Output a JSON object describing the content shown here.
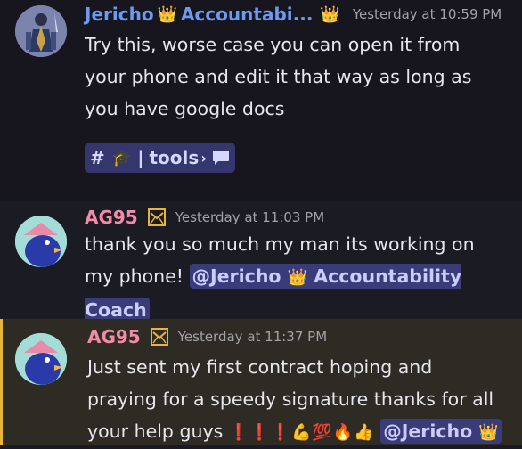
{
  "messages": [
    {
      "author": "Jericho",
      "author_role": "Accountabi...",
      "crown": "👑",
      "timestamp": "Yesterday at 10:59 PM",
      "text": "Try this, worse case you can open it from your phone and edit it that way as long as you have google docs",
      "channel_link": {
        "hash": "#",
        "emoji": "🎓",
        "sep": "|",
        "name": "tools",
        "chevron": "›",
        "icon": "speech-bubble-icon"
      }
    },
    {
      "author": "AG95",
      "timestamp": "Yesterday at 11:03 PM",
      "text": "thank you so much my man its working on my phone! ",
      "mention": {
        "at": "@Jericho",
        "crown": "👑",
        "rest": "Accountability Coach"
      }
    },
    {
      "author": "AG95",
      "timestamp": "Yesterday at 11:37 PM",
      "text": "Just sent my first contract hoping and praying for a speedy signature thanks for all your help guys ",
      "emojis": "❗❗❗💪💯🔥👍",
      "mention": {
        "at": "@Jericho",
        "crown": "👑"
      }
    }
  ],
  "colors": {
    "background": "#1a1a24",
    "highlight": "#2e2a24",
    "highlight_bar": "#e8b33a",
    "name_blue": "#6a9bf0",
    "name_pink": "#f38aa7",
    "mention_bg": "#3a3c7a"
  }
}
